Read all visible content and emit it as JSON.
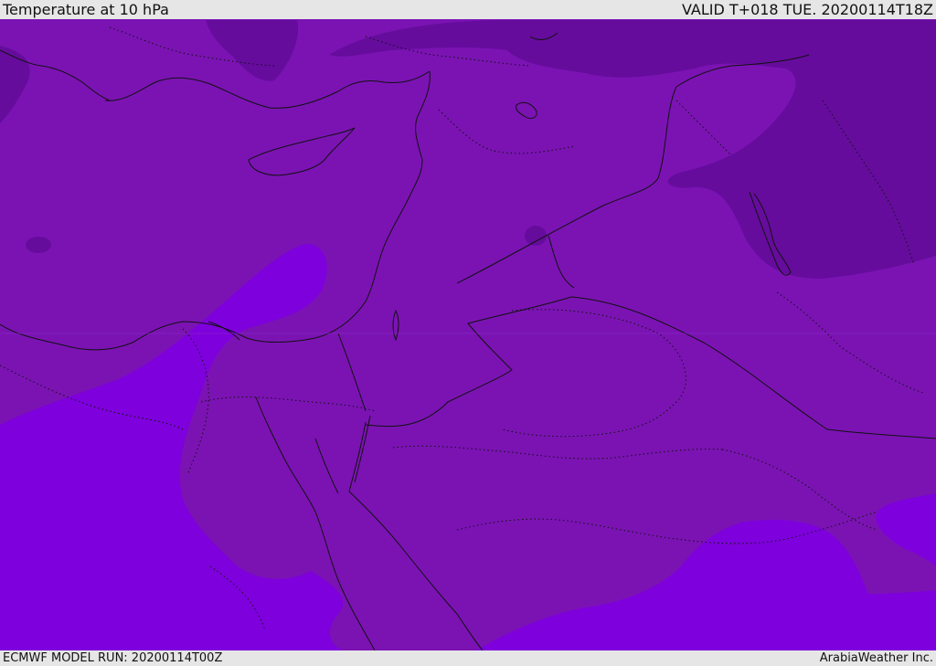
{
  "header": {
    "title": "Temperature at 10 hPa",
    "valid": "VALID T+018 TUE. 20200114T18Z"
  },
  "footer": {
    "model_run": "ECMWF MODEL RUN: 20200114T00Z",
    "credit": "ArabiaWeather Inc."
  },
  "map": {
    "colors": {
      "background_band": "#7b13b3",
      "cold_band": "#650c9c",
      "warm_band": "#7e00dc",
      "border_line": "#111111"
    }
  }
}
